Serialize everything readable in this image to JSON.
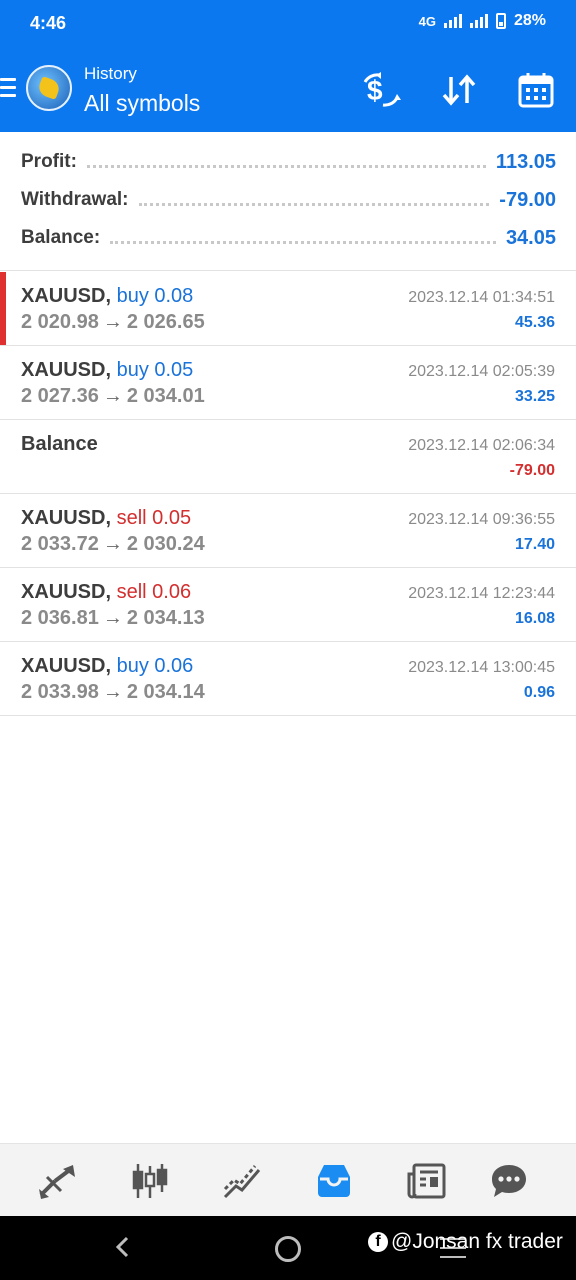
{
  "status_bar": {
    "time": "4:46",
    "network": "4G",
    "battery": "28%"
  },
  "header": {
    "small_title": "History",
    "title": "All symbols"
  },
  "summary": [
    {
      "label": "Profit:",
      "value": "113.05"
    },
    {
      "label": "Withdrawal:",
      "value": "-79.00"
    },
    {
      "label": "Balance:",
      "value": "34.05"
    }
  ],
  "deals": [
    {
      "symbol": "XAUUSD,",
      "side": "buy 0.08",
      "open": "2 020.98",
      "close": "2 026.65",
      "datetime": "2023.12.14 01:34:51",
      "amount": "45.36"
    },
    {
      "symbol": "XAUUSD,",
      "side": "buy 0.05",
      "open": "2 027.36",
      "close": "2 034.01",
      "datetime": "2023.12.14 02:05:39",
      "amount": "33.25"
    },
    {
      "symbol": "Balance",
      "datetime": "2023.12.14 02:06:34",
      "amount": "-79.00"
    },
    {
      "symbol": "XAUUSD,",
      "side": "sell 0.05",
      "open": "2 033.72",
      "close": "2 030.24",
      "datetime": "2023.12.14 09:36:55",
      "amount": "17.40"
    },
    {
      "symbol": "XAUUSD,",
      "side": "sell 0.06",
      "open": "2 036.81",
      "close": "2 034.13",
      "datetime": "2023.12.14 12:23:44",
      "amount": "16.08"
    },
    {
      "symbol": "XAUUSD,",
      "side": "buy 0.06",
      "open": "2 033.98",
      "close": "2 034.14",
      "datetime": "2023.12.14 13:00:45",
      "amount": "0.96"
    }
  ],
  "arrow": "→",
  "bottom_nav": [
    "quotes-icon",
    "chart-icon",
    "trade-icon",
    "history-icon",
    "news-icon",
    "chat-icon"
  ],
  "watermark": "@Jonsan fx trader",
  "colors": {
    "accent": "#0b78f0",
    "positive": "#1a73d9",
    "negative": "#d32f2f",
    "selected_marker": "#e03131"
  }
}
